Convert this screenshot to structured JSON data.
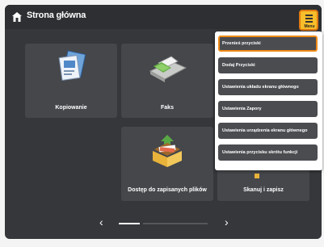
{
  "header": {
    "title": "Strona główna",
    "home_icon": "home-icon",
    "menu_button_label": "Menu"
  },
  "tiles": [
    {
      "label": "Kopiowanie",
      "icon": "copy-icon"
    },
    {
      "label": "Faks",
      "icon": "fax-icon"
    },
    {
      "label": "Dostęp do zapisanych plików",
      "icon": "stored-files-icon"
    },
    {
      "label": "Skanuj i zapisz",
      "icon": "scan-save-icon"
    }
  ],
  "menu": {
    "items": [
      {
        "label": "Przenieś przyciski"
      },
      {
        "label": "Dodaj Przyciski"
      },
      {
        "label": "Ustawienia układu ekranu głównego"
      },
      {
        "label": "Ustawienia Zapory"
      },
      {
        "label": "Ustawienia urządzenia ekranu głównego"
      },
      {
        "label": "Ustawienia przycisku skrótu funkcji"
      }
    ]
  },
  "pager": {
    "prev_icon": "chevron-left-icon",
    "next_icon": "chevron-right-icon"
  },
  "colors": {
    "accent": "#f7bd2a",
    "highlight": "#ef8a18",
    "screen_bg": "#35373a"
  }
}
